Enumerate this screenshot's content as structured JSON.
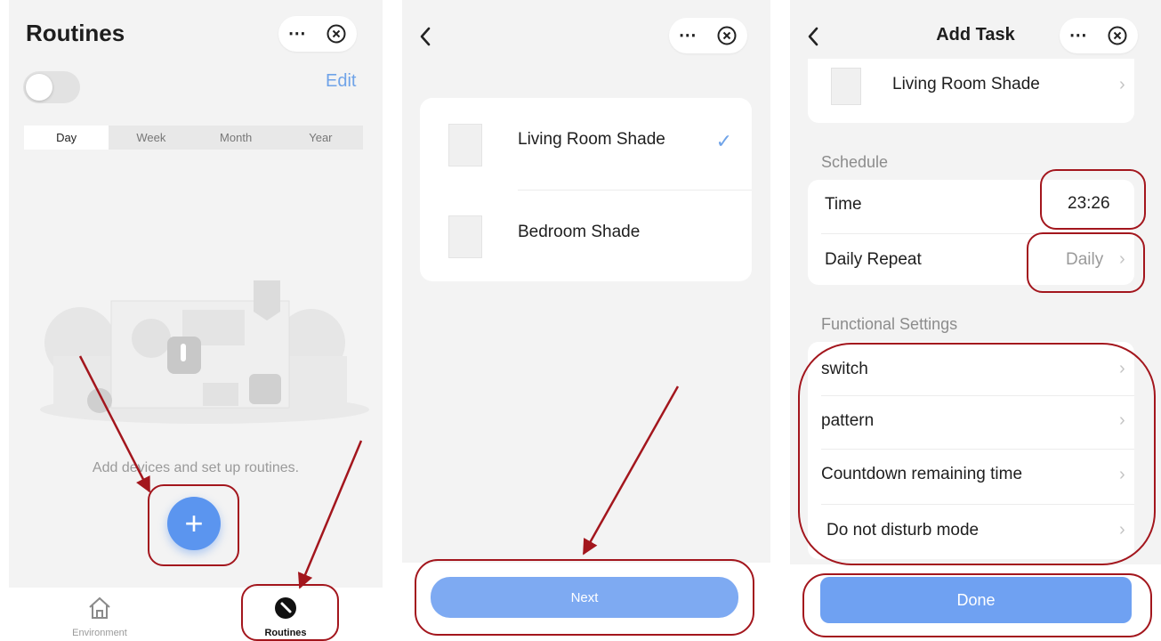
{
  "screen1": {
    "title": "Routines",
    "more_icon": "⋯",
    "edit_label": "Edit",
    "segments": [
      "Day",
      "Week",
      "Month",
      "Year"
    ],
    "empty_hint": "Add devices and set up routines.",
    "add_label": "+",
    "nav": [
      {
        "label": "Environment",
        "icon": "home-icon"
      },
      {
        "label": "Routines",
        "icon": "routines-icon"
      }
    ]
  },
  "screen2": {
    "more_icon": "⋯",
    "devices": [
      {
        "name": "Living Room Shade",
        "selected": true
      },
      {
        "name": "Bedroom Shade",
        "selected": false
      }
    ],
    "check_mark": "✓",
    "next_label": "Next"
  },
  "screen3": {
    "title": "Add Task",
    "more_icon": "⋯",
    "device_name": "Living Room Shade",
    "schedule_label": "Schedule",
    "time_label": "Time",
    "time_value": "23:26",
    "repeat_label": "Daily Repeat",
    "repeat_value": "Daily",
    "functional_label": "Functional Settings",
    "functions": [
      "switch",
      "pattern",
      "Countdown remaining time",
      "Do not disturb mode"
    ],
    "chevron": "›",
    "done_label": "Done"
  },
  "colors": {
    "accent": "#5b95ef",
    "button": "#7eaaf2",
    "link": "#6fa3e8",
    "annotation": "#a3161d"
  }
}
